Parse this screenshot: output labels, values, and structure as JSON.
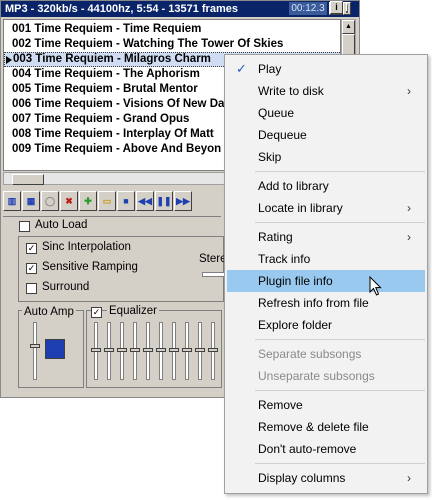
{
  "window": {
    "title": "MP3 - 320kb/s - 44100hz, 5:54 - 13571 frames",
    "time": "00:12.3",
    "buttons": [
      "i",
      "|",
      "_",
      "x"
    ]
  },
  "playlist": [
    {
      "text": "001 Time Requiem - Time Requiem",
      "selected": false
    },
    {
      "text": "002 Time Requiem - Watching The Tower Of Skies",
      "selected": false
    },
    {
      "text": "003 Time Requiem - Milagros Charm",
      "selected": true
    },
    {
      "text": "004 Time Requiem - The Aphorism",
      "selected": false
    },
    {
      "text": "005 Time Requiem - Brutal Mentor",
      "selected": false
    },
    {
      "text": "006 Time Requiem - Visions Of New Da",
      "selected": false
    },
    {
      "text": "007 Time Requiem - Grand Opus",
      "selected": false
    },
    {
      "text": "008 Time Requiem - Interplay Of Matt",
      "selected": false
    },
    {
      "text": "009 Time Requiem - Above And Beyon",
      "selected": false
    }
  ],
  "toolbar_icons": [
    "playlist-icon",
    "equalizer-icon",
    "cd-icon",
    "remove-icon",
    "add-icon",
    "open-folder-icon",
    "stop-icon",
    "previous-icon",
    "pause-icon",
    "next-icon"
  ],
  "options": {
    "auto_load": {
      "label": "Auto Load",
      "checked": false
    },
    "sinc": {
      "label": "Sinc Interpolation",
      "checked": true
    },
    "ramping": {
      "label": "Sensitive Ramping",
      "checked": true
    },
    "surround": {
      "label": "Surround",
      "checked": false
    },
    "stereo_label": "Stere",
    "auto_amp_label": "Auto Amp",
    "equalizer": {
      "label": "Equalizer",
      "checked": true
    }
  },
  "menu": {
    "items": [
      {
        "label": "Play",
        "checked": true
      },
      {
        "label": "Write to disk",
        "submenu": true
      },
      {
        "label": "Queue"
      },
      {
        "label": "Dequeue"
      },
      {
        "label": "Skip"
      },
      {
        "label": "Add to library"
      },
      {
        "label": "Locate in library",
        "submenu": true
      },
      {
        "label": "Rating",
        "submenu": true
      },
      {
        "label": "Track info"
      },
      {
        "label": "Plugin file info",
        "highlighted": true
      },
      {
        "label": "Refresh info from file"
      },
      {
        "label": "Explore folder"
      },
      {
        "label": "Separate subsongs",
        "disabled": true
      },
      {
        "label": "Unseparate subsongs",
        "disabled": true
      },
      {
        "label": "Remove"
      },
      {
        "label": "Remove & delete file"
      },
      {
        "label": "Don't auto-remove"
      },
      {
        "label": "Display columns",
        "submenu": true
      }
    ],
    "check_glyph": "✓",
    "submenu_glyph": "›"
  },
  "colors": {
    "title_bar": "#0a246a",
    "selection": "#cfdcf2",
    "menu_highlight": "#99c9ef",
    "toolbar_icon": "#1d3fb0"
  }
}
